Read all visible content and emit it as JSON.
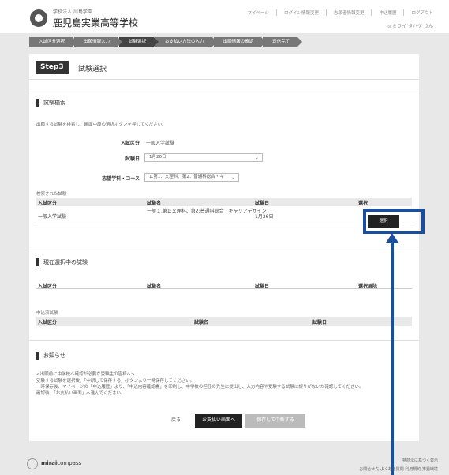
{
  "header": {
    "org": "学校法人 川島学園",
    "school": "鹿児島実業高等学校",
    "links": [
      "マイページ",
      "ログイン情報変更",
      "志願者情報変更",
      "申込履歴",
      "ログアウト"
    ],
    "user": "◎ ミライ タハゲ さん"
  },
  "steps": [
    "入試区分選択",
    "出願情報入力",
    "試験選択",
    "お支払い方法の入力",
    "出願情報の確認",
    "送信完了"
  ],
  "step_head": {
    "badge": "Step3",
    "title": "試験選択"
  },
  "search": {
    "title": "試験検索",
    "note": "出願する試験を検索し、画面中段の選択ボタンを押してください。",
    "exam_type_label": "入試区分",
    "exam_type_value": "一般入学試験",
    "exam_date_label": "試験日",
    "exam_date_value": "1月26日",
    "course_label": "志望学科・コース",
    "course_value": "1.第1：文理科、第2：普通科総合・キ",
    "results_label": "検索された試験",
    "headers": [
      "入試区分",
      "試験名",
      "試験日",
      "選択"
    ],
    "row": {
      "type": "一般入学試験",
      "name": "一般１.第1:文理科、第2:普通科総合・キャリアデザイン",
      "date": "1月26日",
      "select": "選択"
    }
  },
  "selected": {
    "title": "現在選択中の試験",
    "headers": [
      "入試区分",
      "試験名",
      "試験日",
      "選択解除"
    ],
    "applied_label": "申込済試験",
    "applied_headers": [
      "入試区分",
      "試験名",
      "試験日"
    ]
  },
  "notice": {
    "title": "お知らせ",
    "lines": [
      "<出願前に中学校へ確認が必要な受験生の皆様へ>",
      "受験する試験を選択後、「中断して保存する」ボタンより一時保存してください。",
      "一時保存後、マイページの「申込履歴」より、「申込内容確認書」を印刷し、中学校の担任の先生に提出し、入力内容や受験する試験に誤りがないか確認してください。",
      "確認後、「お支払い画面」へ進んでください。"
    ]
  },
  "buttons": {
    "back": "戻る",
    "pay": "お支払い画面へ",
    "save": "保存して中断する"
  },
  "footer": {
    "brand_bold": "mirai",
    "brand_rest": "compass",
    "right1": "特商法に基づく表示",
    "right2": "お問合せ先  よくある質問  利用規約  推奨環境"
  },
  "colors": {
    "accent": "#1a4fa0",
    "dark": "#222222"
  }
}
